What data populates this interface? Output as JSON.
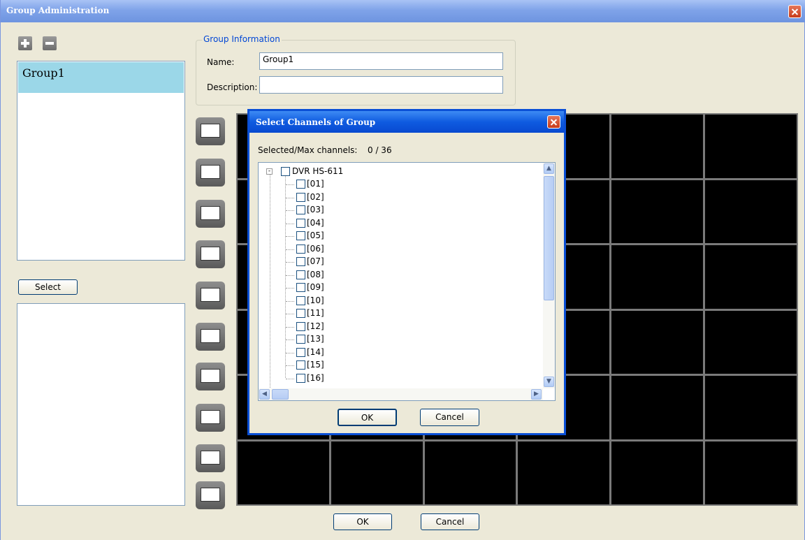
{
  "window": {
    "title": "Group Administration"
  },
  "group_list": {
    "items": [
      "Group1"
    ]
  },
  "select_button": "Select",
  "group_info": {
    "legend": "Group Information",
    "name_label": "Name:",
    "name_value": "Group1",
    "description_label": "Description:",
    "description_value": ""
  },
  "footer": {
    "ok": "OK",
    "cancel": "Cancel"
  },
  "dialog": {
    "title": "Select Channels of Group",
    "selected_label": "Selected/Max channels:",
    "selected_value": "0 / 36",
    "tree_root": "DVR HS-611",
    "channels": [
      "[01]",
      "[02]",
      "[03]",
      "[04]",
      "[05]",
      "[06]",
      "[07]",
      "[08]",
      "[09]",
      "[10]",
      "[11]",
      "[12]",
      "[13]",
      "[14]",
      "[15]",
      "[16]"
    ],
    "ok": "OK",
    "cancel": "Cancel"
  },
  "icons": {
    "add": "plus-icon",
    "remove": "minus-icon",
    "close": "close-icon",
    "layouts": [
      "layout-1-icon",
      "layout-4-icon",
      "layout-9-icon",
      "layout-16-icon",
      "layout-25-icon",
      "layout-36-icon",
      "layout-6-icon",
      "layout-8-icon",
      "layout-13-icon",
      "layout-10-icon"
    ]
  }
}
